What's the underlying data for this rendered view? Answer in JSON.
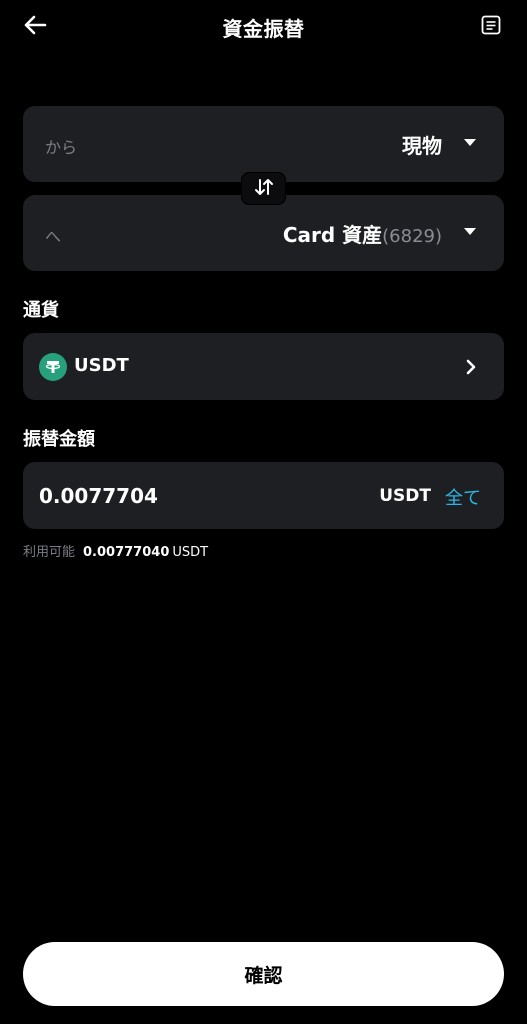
{
  "header": {
    "title": "資金振替",
    "back_icon": "arrow-left-icon",
    "history_icon": "document-list-icon"
  },
  "transfer": {
    "from": {
      "label": "から",
      "account": "現物"
    },
    "to": {
      "label": "へ",
      "account": "Card 資産",
      "count": "(6829)"
    },
    "swap_icon": "swap-vertical-icon"
  },
  "currency": {
    "section_label": "通貨",
    "selected": "USDT",
    "icon": "tether-icon",
    "icon_color": "#26a17b"
  },
  "amount": {
    "section_label": "振替金額",
    "value": "0.0077704",
    "unit": "USDT",
    "max_label": "全て",
    "max_color": "#2db7e6"
  },
  "available": {
    "label": "利用可能",
    "value": "0.00777040",
    "unit": "USDT"
  },
  "confirm": {
    "label": "確認"
  }
}
